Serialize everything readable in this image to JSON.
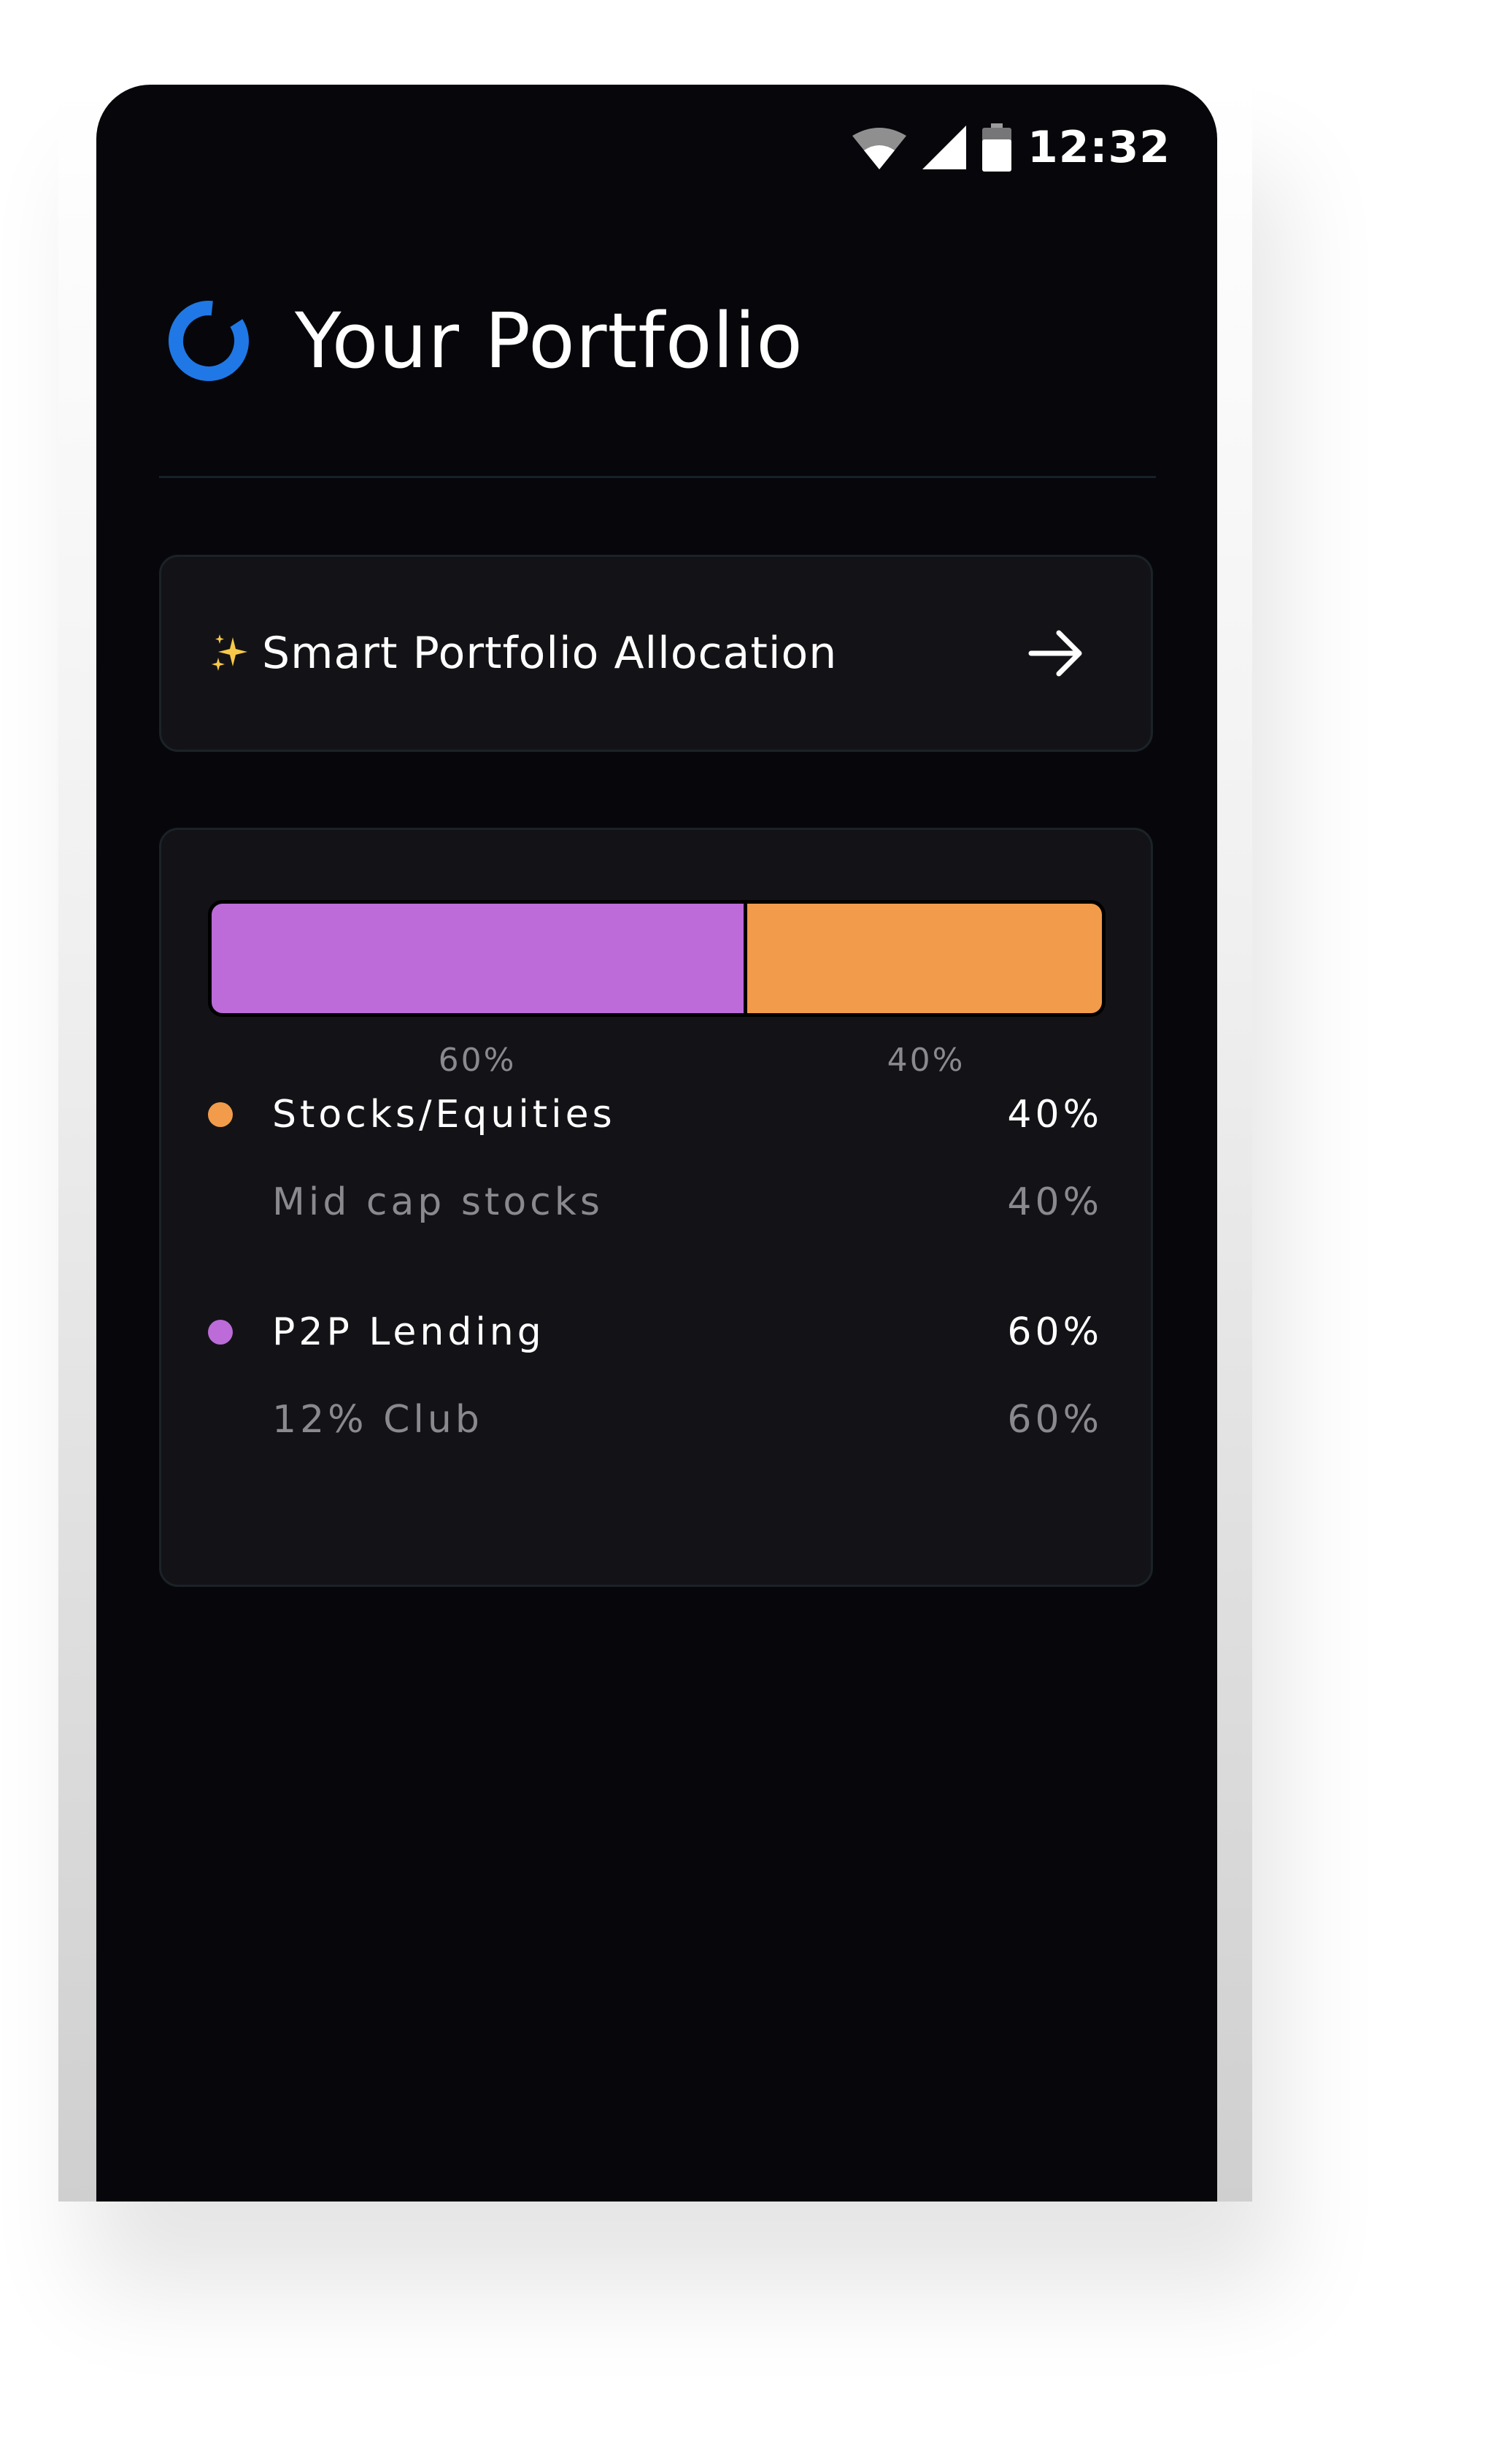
{
  "status_bar": {
    "time": "12:32",
    "icons": [
      "wifi-icon",
      "cellular-signal-icon",
      "battery-icon"
    ]
  },
  "header": {
    "title": "Your Portfolio",
    "logo_icon": "donut-logo-icon",
    "logo_color": "#1f78e6"
  },
  "smart_allocation": {
    "icon": "sparkles-icon",
    "label": "Smart Portfolio Allocation",
    "action_icon": "arrow-right-icon"
  },
  "allocation": {
    "segments": [
      {
        "percent": 60,
        "label": "60%",
        "color": "#bc6bd9"
      },
      {
        "percent": 40,
        "label": "40%",
        "color": "#f29b4b"
      }
    ],
    "categories": [
      {
        "name": "Stocks/Equities",
        "percent": "40%",
        "color": "#f29b4b",
        "sub_name": "Mid cap stocks",
        "sub_percent": "40%"
      },
      {
        "name": "P2P Lending",
        "percent": "60%",
        "color": "#bc6bd9",
        "sub_name": "12% Club",
        "sub_percent": "60%"
      }
    ]
  }
}
